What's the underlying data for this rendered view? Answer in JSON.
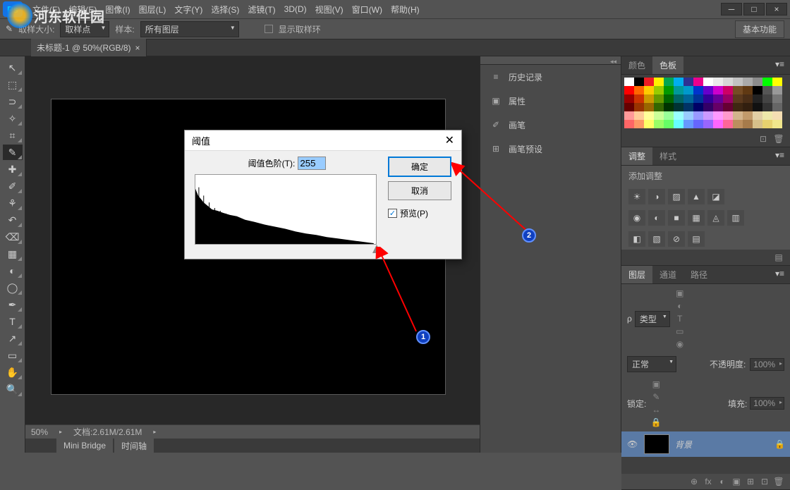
{
  "menubar": {
    "items": [
      "文件(F)",
      "编辑(E)",
      "图像(I)",
      "图层(L)",
      "文字(Y)",
      "选择(S)",
      "滤镜(T)",
      "3D(D)",
      "视图(V)",
      "窗口(W)",
      "帮助(H)"
    ],
    "app_icon": "Ps"
  },
  "window_controls": {
    "minimize": "─",
    "maximize": "□",
    "close": "×"
  },
  "options_bar": {
    "sample_size_label": "取样大小:",
    "sample_size_value": "取样点",
    "sample_label": "样本:",
    "sample_value": "所有图层",
    "show_ring_label": "显示取样环",
    "basic_btn": "基本功能"
  },
  "document_tab": {
    "title": "未标题-1 @ 50%(RGB/8)",
    "close": "×"
  },
  "tools": [
    {
      "name": "move-tool",
      "glyph": "↖"
    },
    {
      "name": "marquee-tool",
      "glyph": "⬚"
    },
    {
      "name": "lasso-tool",
      "glyph": "⊃"
    },
    {
      "name": "wand-tool",
      "glyph": "✧"
    },
    {
      "name": "crop-tool",
      "glyph": "⌗"
    },
    {
      "name": "eyedropper-tool",
      "glyph": "✎",
      "active": true
    },
    {
      "name": "healing-tool",
      "glyph": "✚"
    },
    {
      "name": "brush-tool",
      "glyph": "✐"
    },
    {
      "name": "stamp-tool",
      "glyph": "⚘"
    },
    {
      "name": "history-brush-tool",
      "glyph": "↶"
    },
    {
      "name": "eraser-tool",
      "glyph": "⌫"
    },
    {
      "name": "gradient-tool",
      "glyph": "▦"
    },
    {
      "name": "blur-tool",
      "glyph": "◐"
    },
    {
      "name": "dodge-tool",
      "glyph": "◯"
    },
    {
      "name": "pen-tool",
      "glyph": "✒"
    },
    {
      "name": "type-tool",
      "glyph": "T"
    },
    {
      "name": "path-tool",
      "glyph": "↗"
    },
    {
      "name": "shape-tool",
      "glyph": "▭"
    },
    {
      "name": "hand-tool",
      "glyph": "✋"
    },
    {
      "name": "zoom-tool",
      "glyph": "🔍"
    }
  ],
  "status": {
    "zoom": "50%",
    "doc_size": "文档:2.61M/2.61M"
  },
  "bottom_tabs": [
    "Mini Bridge",
    "时间轴"
  ],
  "narrow_panel": {
    "items": [
      {
        "icon": "≡",
        "label": "历史记录"
      },
      {
        "icon": "▣",
        "label": "属性"
      },
      {
        "icon": "✐",
        "label": "画笔"
      },
      {
        "icon": "⊞",
        "label": "画笔预设"
      }
    ]
  },
  "color_panel": {
    "tabs": [
      "颜色",
      "色板"
    ],
    "active_tab": 1,
    "swatch_colors": [
      "#ffffff",
      "#000000",
      "#ed1c24",
      "#fff200",
      "#00a651",
      "#00aeef",
      "#2e3192",
      "#ec008c",
      "#ffffff",
      "#ebebeb",
      "#d7d7d7",
      "#c2c2c2",
      "#aaaaaa",
      "#8c8c8c",
      "#00ff00",
      "#ffff00",
      "#ff0000",
      "#ff6600",
      "#ffcc00",
      "#99cc00",
      "#009900",
      "#009999",
      "#0099cc",
      "#0033cc",
      "#6600cc",
      "#cc00cc",
      "#cc0066",
      "#754c24",
      "#603913",
      "#000000",
      "#555555",
      "#999999",
      "#990000",
      "#cc3300",
      "#cc9900",
      "#669900",
      "#006600",
      "#006666",
      "#006699",
      "#003399",
      "#330099",
      "#660099",
      "#990066",
      "#5b3a1e",
      "#4a2e17",
      "#222222",
      "#444444",
      "#777777",
      "#660000",
      "#993300",
      "#996600",
      "#336600",
      "#003300",
      "#003333",
      "#003366",
      "#000066",
      "#330066",
      "#660066",
      "#660033",
      "#3e2712",
      "#321f0f",
      "#111111",
      "#333333",
      "#666666",
      "#ff9999",
      "#ffcc99",
      "#ffff99",
      "#ccff99",
      "#99ff99",
      "#99ffff",
      "#99ccff",
      "#9999ff",
      "#cc99ff",
      "#ff99ff",
      "#ff99cc",
      "#d2b48c",
      "#c19a6b",
      "#e2cfa5",
      "#eee8aa",
      "#f5deb3",
      "#ff6666",
      "#ff9966",
      "#ffff66",
      "#99ff66",
      "#66ff66",
      "#66ffff",
      "#6699ff",
      "#6666ff",
      "#9966ff",
      "#ff66ff",
      "#ff6699",
      "#bc8f5e",
      "#a67b4b",
      "#d6c08a",
      "#e6d16f",
      "#f0e68c"
    ]
  },
  "adjustments_panel": {
    "tabs": [
      "调整",
      "样式"
    ],
    "active_tab": 0,
    "add_label": "添加调整",
    "row1": [
      "☀",
      "◑",
      "▨",
      "▲",
      "◪"
    ],
    "row2": [
      "◉",
      "◐",
      "■",
      "▦",
      "◬",
      "▥"
    ],
    "row3": [
      "◧",
      "▧",
      "⊘",
      "▤"
    ]
  },
  "layers_panel": {
    "tabs": [
      "图层",
      "通道",
      "路径"
    ],
    "active_tab": 0,
    "kind_label": "类型",
    "filter_icons": [
      "▣",
      "◐",
      "T",
      "▭",
      "◉"
    ],
    "blend_mode": "正常",
    "opacity_label": "不透明度:",
    "opacity_value": "100%",
    "lock_label": "锁定:",
    "lock_icons": [
      "▣",
      "✎",
      "↔",
      "🔒"
    ],
    "fill_label": "填充:",
    "fill_value": "100%",
    "layer": {
      "name": "背景",
      "visible": "👁",
      "locked": "🔒"
    },
    "bottom_icons": [
      "⊕",
      "fx",
      "◐",
      "▣",
      "⊞",
      "⊡",
      "🗑"
    ]
  },
  "dialog": {
    "title": "阈值",
    "input_label": "阈值色阶(T):",
    "input_value": "255",
    "ok": "确定",
    "cancel": "取消",
    "preview": "预览(P)"
  },
  "annotations": {
    "marker1": "1",
    "marker2": "2"
  },
  "watermark": "河东软件园"
}
